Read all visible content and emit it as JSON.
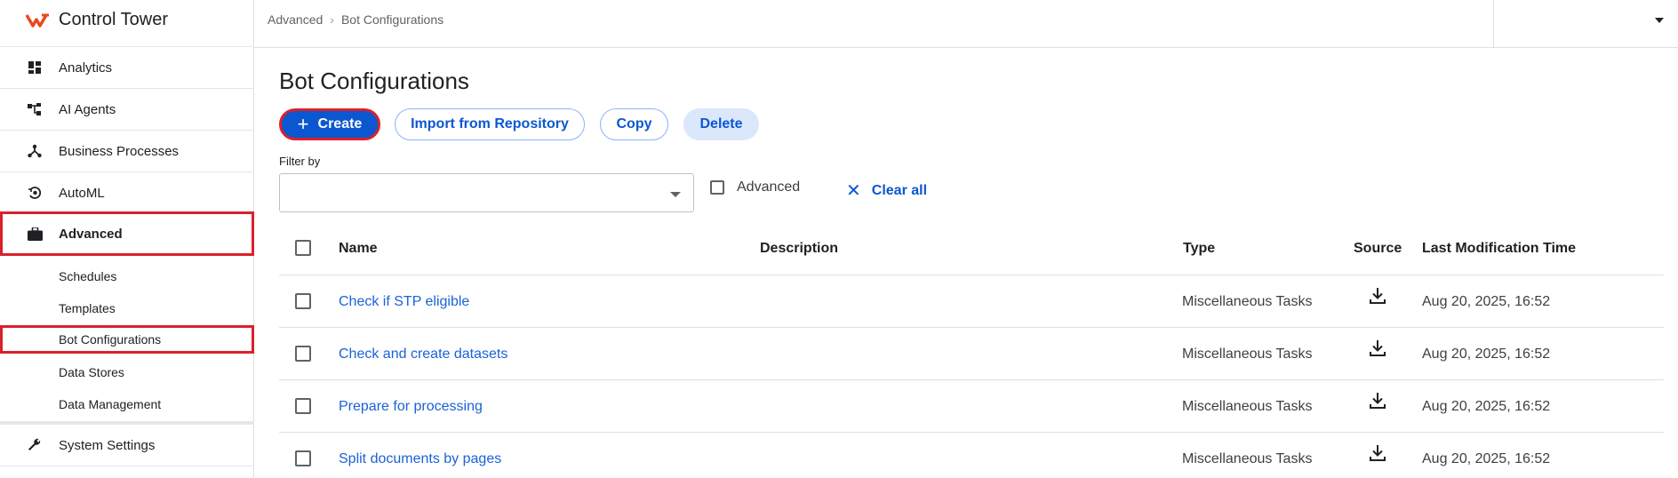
{
  "app": {
    "name": "Control Tower"
  },
  "sidebar": {
    "items": [
      {
        "label": "Analytics",
        "icon": "dashboard-icon"
      },
      {
        "label": "AI Agents",
        "icon": "ai-agents-icon"
      },
      {
        "label": "Business Processes",
        "icon": "process-icon"
      },
      {
        "label": "AutoML",
        "icon": "automl-icon"
      },
      {
        "label": "Advanced",
        "icon": "briefcase-icon",
        "active": true
      },
      {
        "label": "System Settings",
        "icon": "wrench-icon"
      }
    ],
    "subitems": [
      {
        "label": "Schedules"
      },
      {
        "label": "Templates"
      },
      {
        "label": "Bot Configurations",
        "active": true
      },
      {
        "label": "Data Stores"
      },
      {
        "label": "Data Management"
      }
    ]
  },
  "breadcrumb": {
    "parent": "Advanced",
    "current": "Bot Configurations"
  },
  "page": {
    "title": "Bot Configurations"
  },
  "toolbar": {
    "create": "Create",
    "import": "Import from Repository",
    "copy": "Copy",
    "delete": "Delete"
  },
  "filter": {
    "label": "Filter by",
    "selected": "",
    "advanced_label": "Advanced",
    "clear_all": "Clear all"
  },
  "table": {
    "headers": {
      "name": "Name",
      "description": "Description",
      "type": "Type",
      "source": "Source",
      "modified": "Last Modification Time"
    },
    "rows": [
      {
        "name": "Check if STP eligible",
        "description": "",
        "type": "Miscellaneous Tasks",
        "source_icon": "download-icon",
        "modified": "Aug 20, 2025, 16:52"
      },
      {
        "name": "Check and create datasets",
        "description": "",
        "type": "Miscellaneous Tasks",
        "source_icon": "download-icon",
        "modified": "Aug 20, 2025, 16:52"
      },
      {
        "name": "Prepare for processing",
        "description": "",
        "type": "Miscellaneous Tasks",
        "source_icon": "download-icon",
        "modified": "Aug 20, 2025, 16:52"
      },
      {
        "name": "Split documents by pages",
        "description": "",
        "type": "Miscellaneous Tasks",
        "source_icon": "download-icon",
        "modified": "Aug 20, 2025, 16:52"
      }
    ]
  },
  "colors": {
    "primary": "#0b57d0",
    "highlight": "#d9212c",
    "link": "#1a62d6",
    "brand": "#e8491d"
  }
}
